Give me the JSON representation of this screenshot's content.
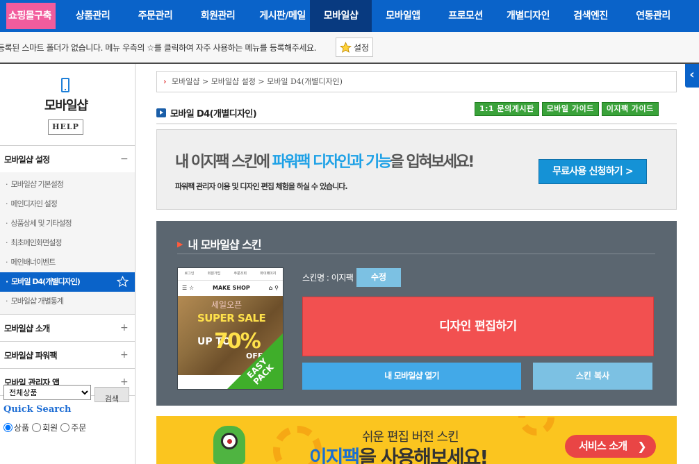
{
  "nav": {
    "items": [
      {
        "label": "쇼핑몰구축"
      },
      {
        "label": "상품관리"
      },
      {
        "label": "주문관리"
      },
      {
        "label": "회원관리"
      },
      {
        "label": "게시판/메일"
      },
      {
        "label": "모바일샵"
      },
      {
        "label": "모바일앱"
      },
      {
        "label": "프로모션"
      },
      {
        "label": "개별디자인"
      },
      {
        "label": "검색엔진"
      },
      {
        "label": "연동관리"
      }
    ],
    "active": "모바일샵"
  },
  "favbar": {
    "message": "등록된 스마트 폴더가 없습니다. 메뉴 우측의 ☆를 클릭하여 자주 사용하는 메뉴를 등록해주세요.",
    "settings_label": "설정"
  },
  "sidebar": {
    "title": "모바일샵",
    "help_label": "HELP",
    "sections": [
      {
        "label": "모바일샵 설정",
        "toggle": "−",
        "items": [
          {
            "label": "모바일샵 기본설정"
          },
          {
            "label": "메인디자인 설정"
          },
          {
            "label": "상품상세 및 기타설정"
          },
          {
            "label": "최초메인화면설정"
          },
          {
            "label": "메인배너이벤트"
          },
          {
            "label": "모바일 D4(개별디자인)"
          },
          {
            "label": "모바일샵 개별통계"
          }
        ]
      },
      {
        "label": "모바일샵 소개",
        "toggle": "+"
      },
      {
        "label": "모바일샵 파워팩",
        "toggle": "+"
      },
      {
        "label": "모바일 관리자 앱",
        "toggle": "+"
      }
    ],
    "quick_search": {
      "title": "Quick Search",
      "options": [
        "상품",
        "회원",
        "주문"
      ],
      "selected": "상품",
      "select_value": "전체상품",
      "button_label": "검색"
    }
  },
  "main": {
    "breadcrumb": "모바일샵 > 모바일샵 설정 > 모바일 D4(개별디자인)",
    "page_title": "모바일 D4(개별디자인)",
    "guide_buttons": [
      "1:1 문의게시판",
      "모바일 가이드",
      "이지팩 가이드"
    ],
    "promo": {
      "headline_1": "내 이지팩 스킨에 ",
      "headline_highlight": "파워팩 디자인과 기능",
      "headline_2": "을 입혀보세요!",
      "subtext": "파워팩 관리자 이용 및 디자인 편집 체험을 하실 수 있습니다.",
      "button_label": "무료사용 신청하기 >"
    },
    "skin_panel": {
      "title": "내 모바일샵 스킨",
      "skin_name": "스킨명 : 이지팩",
      "edit_label": "수정",
      "design_label": "디자인 편집하기",
      "open_label": "내 모바일샵 열기",
      "copy_label": "스킨 복사",
      "thumb": {
        "top_links": [
          "로그인",
          "회원가입",
          "주문조회",
          "마이페이지"
        ],
        "shop_name": "MAKE SHOP",
        "sale_top": "세일오픈",
        "sale_line": "SUPER SALE",
        "up_to": "UP TO",
        "percent": "70%",
        "off": "OFF",
        "badge": "EASY PACK"
      }
    },
    "banner": {
      "small": "쉬운 편집 버전 스킨",
      "big_highlight": "이지팩",
      "big_rest": "을 사용해보세요!",
      "service_label": "서비스 소개"
    }
  },
  "colors": {
    "nav_blue": "#0a63c9",
    "nav_active": "#083a80",
    "pink": "#f25c9d",
    "design_red": "#f25050",
    "banner_yellow": "#fbc51f"
  }
}
